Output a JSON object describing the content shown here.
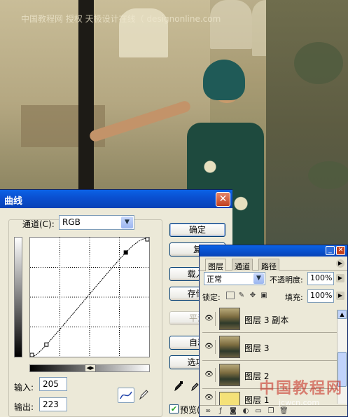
{
  "watermark": "中国教程网 授权 天极设计在线（ designonline.com",
  "curves": {
    "title": "曲线",
    "close": "✕",
    "channel_label": "通道(C):",
    "channel_value": "RGB",
    "input_label": "输入:",
    "input_value": "205",
    "output_label": "输出:",
    "output_value": "223",
    "buttons": {
      "ok": "确定",
      "reset": "复",
      "load": "载入(",
      "save": "存储(",
      "smooth": "平滑",
      "auto": "自动",
      "options": "选项("
    },
    "preview_label": "预览(",
    "preview_checked": true,
    "curve_points": [
      [
        0,
        0
      ],
      [
        35,
        26
      ],
      [
        205,
        223
      ],
      [
        255,
        255
      ]
    ]
  },
  "layers": {
    "tabs": [
      "图层",
      "通道",
      "路径"
    ],
    "blend_mode": "正常",
    "opacity_label": "不透明度:",
    "opacity_value": "100%",
    "lock_label": "锁定:",
    "fill_label": "填充:",
    "fill_value": "100%",
    "rows": [
      {
        "name": "图层 3 副本",
        "thumb": "photo"
      },
      {
        "name": "图层 3",
        "thumb": "photo"
      },
      {
        "name": "图层 2",
        "thumb": "photo"
      },
      {
        "name": "图层 1",
        "thumb": "yellow"
      }
    ]
  },
  "bottom_watermark": "中国教程网",
  "bottom_watermark_url": "jcwcn.com"
}
